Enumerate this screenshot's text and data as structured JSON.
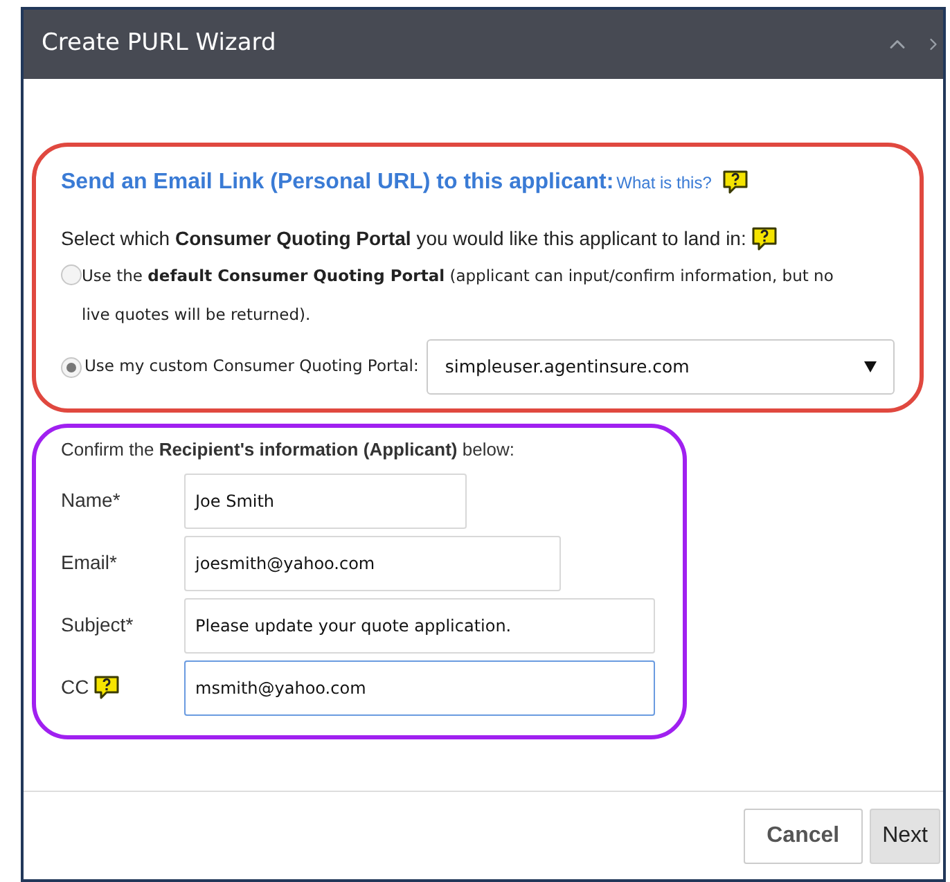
{
  "window": {
    "title": "Create PURL Wizard"
  },
  "portal_section": {
    "heading": "Send an Email Link (Personal URL) to this applicant:",
    "help_link": "What is this?",
    "prompt": "Select which **Consumer Quoting Portal** you would like this applicant to land in:",
    "options": [
      {
        "kind": "text",
        "label": "Use the **default Consumer Quoting Portal** (applicant can input/confirm information, but no live quotes will be returned).",
        "selected": false
      },
      {
        "kind": "select",
        "label": "Use my custom Consumer Quoting Portal:",
        "selected": true,
        "value": "simpleuser.agentinsure.com"
      }
    ]
  },
  "recipient_section": {
    "prompt": "Confirm the **Recipient's information (Applicant)** below:",
    "fields": [
      {
        "label": "Name*",
        "value": "Joe Smith",
        "help": false,
        "focused": false
      },
      {
        "label": "Email*",
        "value": "joesmith@yahoo.com",
        "help": false,
        "focused": false
      },
      {
        "label": "Subject*",
        "value": "Please update your quote application.",
        "help": false,
        "focused": false
      },
      {
        "label": "CC",
        "value": "msmith@yahoo.com",
        "help": true,
        "focused": true
      }
    ]
  },
  "buttons": [
    {
      "label": "Cancel",
      "kind": "secondary"
    },
    {
      "label": "Next",
      "kind": "primary"
    }
  ]
}
